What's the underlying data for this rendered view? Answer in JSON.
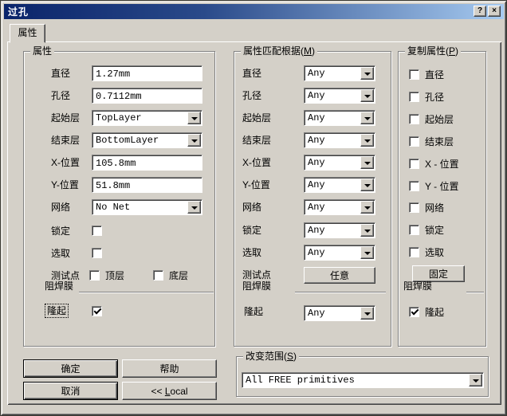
{
  "window": {
    "title": "过孔",
    "help_label": "?",
    "close_label": "×"
  },
  "tab": {
    "label": "属性"
  },
  "left_group": {
    "title": "属性",
    "rows": [
      {
        "label": "直径",
        "value": "1.27mm"
      },
      {
        "label": "孔径",
        "value": "0.7112mm"
      },
      {
        "label": "起始层",
        "value": "TopLayer"
      },
      {
        "label": "结束层",
        "value": "BottomLayer"
      },
      {
        "label": "X-位置",
        "value": "105.8mm"
      },
      {
        "label": "Y-位置",
        "value": "51.8mm"
      },
      {
        "label": "网络",
        "value": "No Net"
      },
      {
        "label": "锁定",
        "checked": false
      },
      {
        "label": "选取",
        "checked": false
      }
    ],
    "testpoint": {
      "label": "测试点",
      "top": {
        "label": "顶层",
        "checked": false
      },
      "bottom": {
        "label": "底层",
        "checked": false
      }
    },
    "solder_mask_label": "阻焊膜",
    "tenting": {
      "label": "隆起",
      "checked": true
    }
  },
  "match_group": {
    "title_prefix": "属性匹配根据(",
    "title_mnemonic": "M",
    "title_suffix": ")",
    "rows": [
      {
        "label": "直径",
        "value": "Any"
      },
      {
        "label": "孔径",
        "value": "Any"
      },
      {
        "label": "起始层",
        "value": "Any"
      },
      {
        "label": "结束层",
        "value": "Any"
      },
      {
        "label": "X-位置",
        "value": "Any"
      },
      {
        "label": "Y-位置",
        "value": "Any"
      },
      {
        "label": "网络",
        "value": "Any"
      },
      {
        "label": "锁定",
        "value": "Any"
      },
      {
        "label": "选取",
        "value": "Any"
      }
    ],
    "testpoint": {
      "label": "测试点",
      "button_label": "任意"
    },
    "solder_mask_label": "阻焊膜",
    "tenting": {
      "label": "隆起",
      "value": "Any"
    }
  },
  "copy_group": {
    "title_prefix": "复制属性(",
    "title_mnemonic": "P",
    "title_suffix": ")",
    "items": [
      {
        "label": "直径",
        "checked": false
      },
      {
        "label": "孔径",
        "checked": false
      },
      {
        "label": "起始层",
        "checked": false
      },
      {
        "label": "结束层",
        "checked": false
      },
      {
        "label": "X - 位置",
        "checked": false
      },
      {
        "label": "Y - 位置",
        "checked": false
      },
      {
        "label": "网络",
        "checked": false
      },
      {
        "label": "锁定",
        "checked": false
      },
      {
        "label": "选取",
        "checked": false
      }
    ],
    "fixed_button_label": "固定",
    "solder_mask_label": "阻焊膜",
    "tenting": {
      "label": "隆起",
      "checked": true
    }
  },
  "scope_group": {
    "title_prefix": "改变范围(",
    "title_mnemonic": "S",
    "title_suffix": ")",
    "value": "All FREE primitives"
  },
  "action_buttons": {
    "ok": "确定",
    "help": "帮助",
    "cancel": "取消",
    "local_prefix": "<< ",
    "local_mnemonic": "L",
    "local_suffix": "ocal"
  },
  "colors": {
    "dialog_bg": "#d4d0c8",
    "titlebar_gradient_start": "#0a246a",
    "titlebar_gradient_end": "#a6caf0",
    "title_text": "#ffffff",
    "field_bg": "#ffffff",
    "text": "#000000"
  },
  "icons": {
    "titlebar_help": "question-mark-icon",
    "titlebar_close": "close-x-icon",
    "combo_arrow": "chevron-down-icon",
    "checkbox_check": "checkmark-icon"
  }
}
